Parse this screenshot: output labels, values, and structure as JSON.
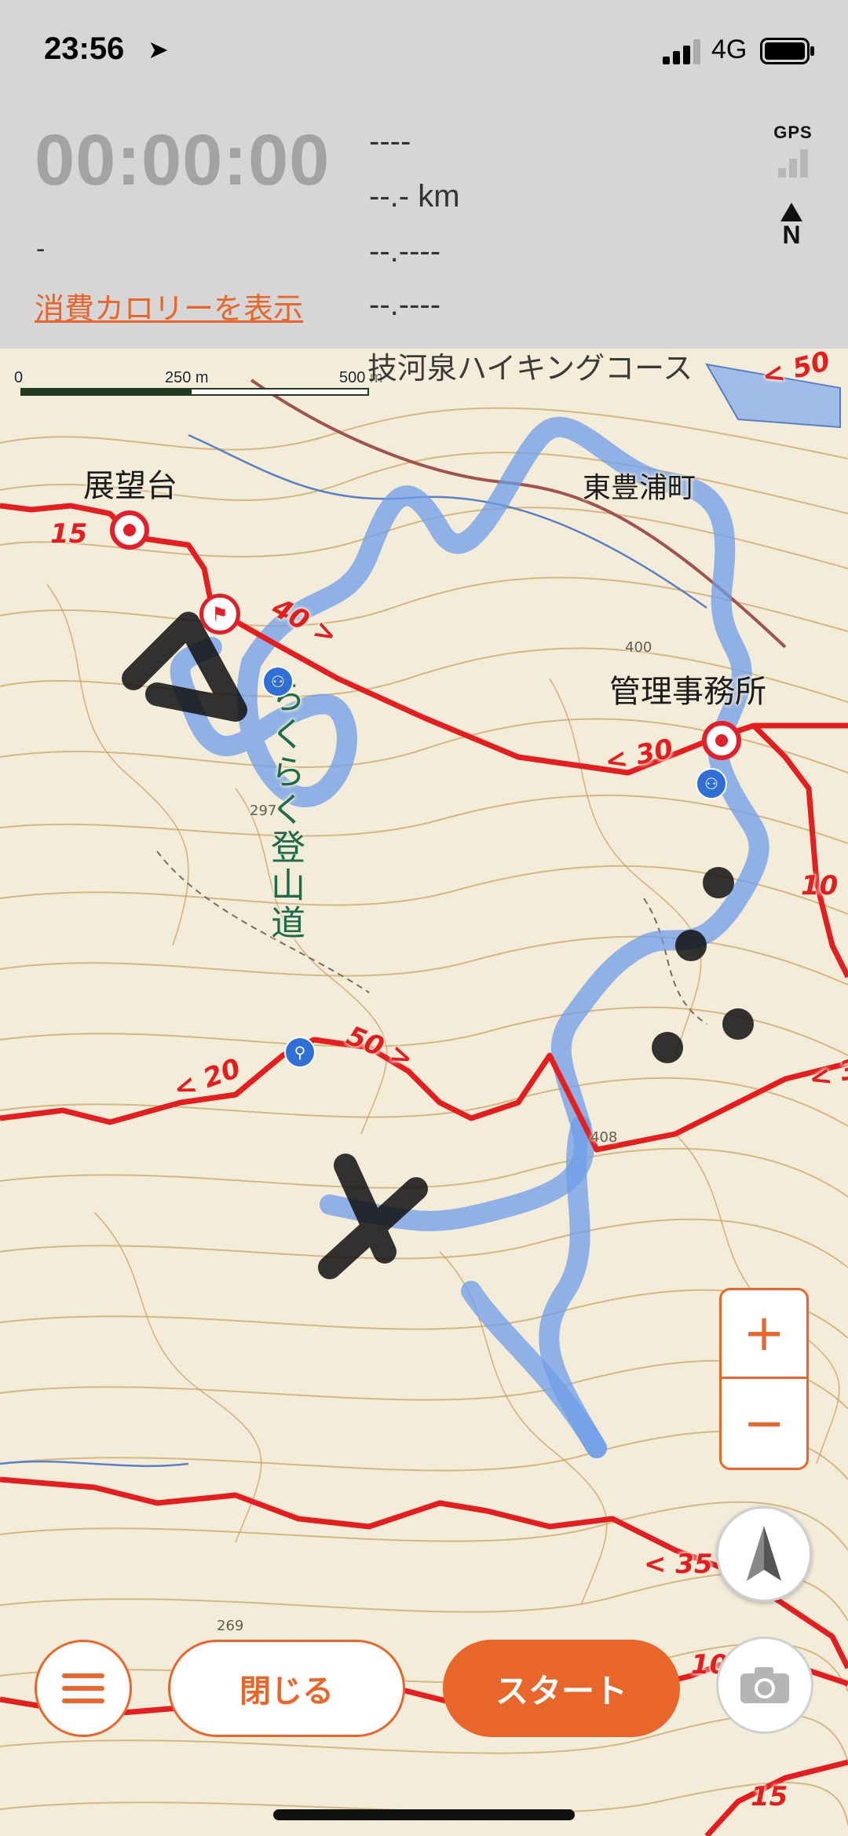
{
  "status_bar": {
    "time": "23:56",
    "location_icon": "location-arrow-icon",
    "network": "4G",
    "signal_icon": "cellular-signal-icon",
    "battery_icon": "battery-icon"
  },
  "tracker": {
    "elapsed_time": "00:00:00",
    "left_stat": "-",
    "calorie_link": "消費カロリーを表示",
    "stats": [
      "----",
      "--.- km",
      "--.----",
      "--.----"
    ],
    "gps_label": "GPS",
    "gps_signal_level": 0,
    "north_label": "N"
  },
  "map": {
    "scale": {
      "zero": "0",
      "mid": "250 m",
      "max": "500 m"
    },
    "labels": {
      "observation_deck": "展望台",
      "town": "東豊浦町",
      "office": "管理事務所",
      "trail": "らくらく登山道",
      "course_partial": "技河泉ハイキングコース",
      "elevation_297": "297",
      "elevation_408": "408",
      "elevation_269": "269",
      "elevation_400": "400"
    },
    "route_markers": {
      "m15_top": "15",
      "m40": "40 >",
      "m30": "< 30",
      "m10_right": "10",
      "m20": "< 20",
      "m50": "50 >",
      "m35": "< 35",
      "m10_bottom": "10",
      "m15_bottom": "15",
      "m50_top": "< 50",
      "m3_right": "< 3"
    },
    "colors": {
      "route_red": "#e41e1e",
      "track_blue": "#6d9de8",
      "contour": "#c9a36a",
      "accent": "#e8662a"
    }
  },
  "controls": {
    "zoom_in": "+",
    "zoom_out": "−",
    "compass_icon": "compass-arrow-icon",
    "menu_icon": "hamburger-menu-icon",
    "close_label": "閉じる",
    "start_label": "スタート",
    "camera_icon": "camera-icon"
  }
}
